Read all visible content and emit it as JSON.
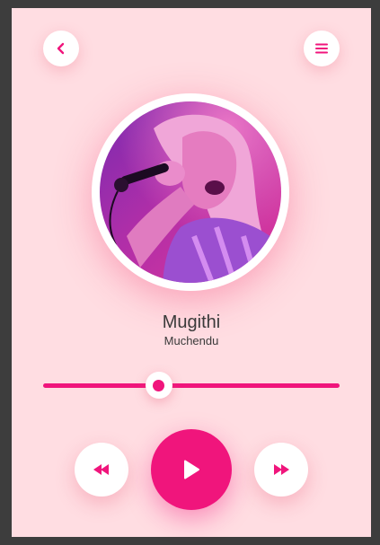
{
  "player": {
    "song_title": "Mugithi",
    "artist": "Muchendu",
    "progress_fraction": 0.39
  },
  "icons": {
    "back": "chevron-left-icon",
    "menu": "hamburger-menu-icon",
    "rewind": "rewind-icon",
    "play": "play-icon",
    "forward": "fast-forward-icon"
  },
  "colors": {
    "accent": "#f0157c",
    "background": "#ffdde2",
    "button": "#ffffff",
    "text": "#3a3a3a"
  }
}
